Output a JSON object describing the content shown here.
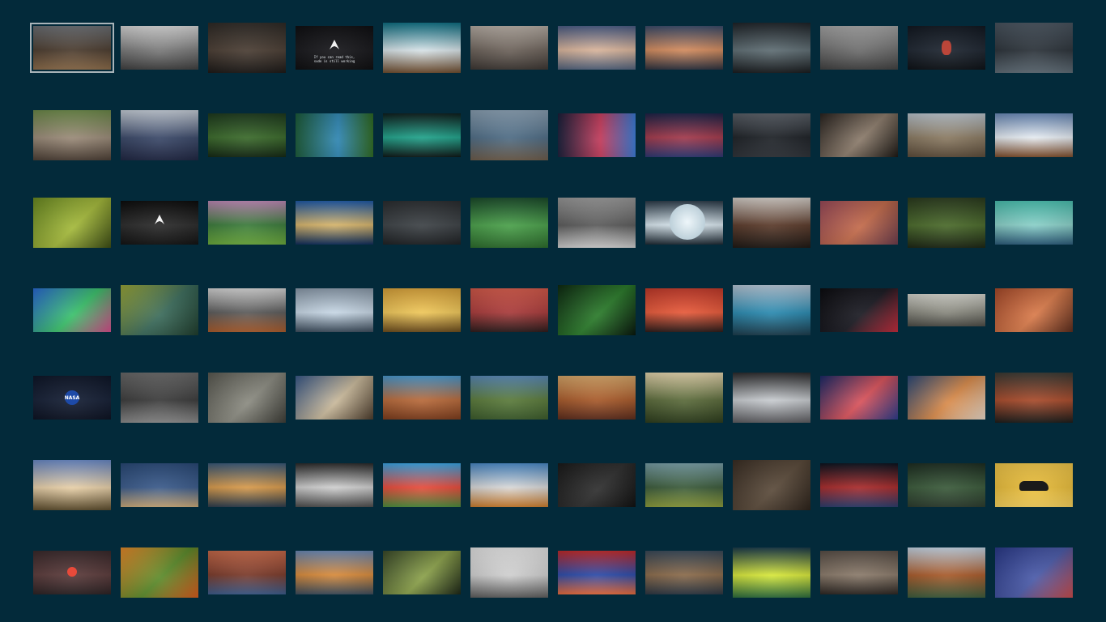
{
  "gallery": {
    "background": "#032a3a",
    "selection_color": "#a9b4b9",
    "columns": 12,
    "rows": 7,
    "selected_index": 0,
    "items": [
      {
        "name": "mountain-cliff-sunset",
        "colors": [
          "#6b6f74",
          "#4a3b2e",
          "#8a6a48"
        ],
        "aspect": "wide",
        "angle": 180
      },
      {
        "name": "beach-bw",
        "colors": [
          "#d9d9d9",
          "#7a7a7a",
          "#3d3d3d"
        ],
        "aspect": "wide",
        "angle": 180
      },
      {
        "name": "forest-path-dark",
        "colors": [
          "#2e2a26",
          "#4a3d33",
          "#1a1715"
        ],
        "aspect": "tall",
        "angle": 180
      },
      {
        "name": "arch-logo-black",
        "colors": [
          "#0f0f12",
          "#16161a",
          "#0c0c0e"
        ],
        "aspect": "wide",
        "angle": 180,
        "logo": "arch",
        "text": "If you can read this,\nsudo is still working"
      },
      {
        "name": "snowy-peaks-teal",
        "colors": [
          "#0d6f83",
          "#d7e3e8",
          "#6b4a2c"
        ],
        "aspect": "tall",
        "angle": 180
      },
      {
        "name": "camera-grey",
        "colors": [
          "#b7aea5",
          "#6c625a",
          "#3a3430"
        ],
        "aspect": "wide",
        "angle": 180
      },
      {
        "name": "road-dusk",
        "colors": [
          "#4b5d86",
          "#d9b49a",
          "#50607a"
        ],
        "aspect": "wide",
        "angle": 180
      },
      {
        "name": "lake-sunset-orange",
        "colors": [
          "#3b4c6b",
          "#d38b5d",
          "#2b2f3c"
        ],
        "aspect": "wide",
        "angle": 180
      },
      {
        "name": "reflection-trees",
        "colors": [
          "#1e2328",
          "#5e6d73",
          "#16191c"
        ],
        "aspect": "tall",
        "angle": 180
      },
      {
        "name": "lone-tree-grey",
        "colors": [
          "#a6a6a6",
          "#6d6d6d",
          "#3f3f3f"
        ],
        "aspect": "wide",
        "angle": 180
      },
      {
        "name": "astronaut-dark",
        "colors": [
          "#121821",
          "#1d2530",
          "#0b0f14"
        ],
        "aspect": "wide",
        "angle": 180,
        "dot": "#d64a3a"
      },
      {
        "name": "figure-concrete",
        "colors": [
          "#4a5560",
          "#2a3138",
          "#5d6a74"
        ],
        "aspect": "tall",
        "angle": 180
      },
      {
        "name": "rocky-shore",
        "colors": [
          "#6d8a4a",
          "#9a8a78",
          "#4a3d33"
        ],
        "aspect": "tall",
        "angle": 180
      },
      {
        "name": "curtain-room",
        "colors": [
          "#c8d0da",
          "#3a4868",
          "#1d2440"
        ],
        "aspect": "tall",
        "angle": 180
      },
      {
        "name": "green-forest-night",
        "colors": [
          "#1e3a1e",
          "#3a6a2a",
          "#122612"
        ],
        "aspect": "wide",
        "angle": 180
      },
      {
        "name": "green-valley-blue",
        "colors": [
          "#1c5c3a",
          "#2f86b3",
          "#2e6a22"
        ],
        "aspect": "wide",
        "angle": 90
      },
      {
        "name": "cyber-neon-room",
        "colors": [
          "#0f1f1e",
          "#20a38b",
          "#0b1615"
        ],
        "aspect": "wide",
        "angle": 180
      },
      {
        "name": "pier-lake",
        "colors": [
          "#8aa0b3",
          "#4d6b84",
          "#6b5a48"
        ],
        "aspect": "tall",
        "angle": 180
      },
      {
        "name": "space-window",
        "colors": [
          "#1a1f3a",
          "#c23a5a",
          "#3a7ad6"
        ],
        "aspect": "wide",
        "angle": 90
      },
      {
        "name": "cloud-red-sky",
        "colors": [
          "#1d2348",
          "#a2384a",
          "#2b3570"
        ],
        "aspect": "wide",
        "angle": 180
      },
      {
        "name": "dark-clouds-city",
        "colors": [
          "#5a6068",
          "#1c2025",
          "#2d3137"
        ],
        "aspect": "wide",
        "angle": 180
      },
      {
        "name": "piano-keys",
        "colors": [
          "#2a2420",
          "#8a7a6a",
          "#1a1612"
        ],
        "aspect": "wide",
        "angle": 135
      },
      {
        "name": "balloon-cliff",
        "colors": [
          "#bcc6cf",
          "#8a7a62",
          "#5a4a38"
        ],
        "aspect": "wide",
        "angle": 180
      },
      {
        "name": "snowy-lake-reflection",
        "colors": [
          "#6a8ab8",
          "#e6ecf2",
          "#7a4a28"
        ],
        "aspect": "wide",
        "angle": 180
      },
      {
        "name": "green-sprouts",
        "colors": [
          "#6a8a22",
          "#a3b83a",
          "#3a4a12"
        ],
        "aspect": "tall",
        "angle": 135
      },
      {
        "name": "arch-logo-smoke",
        "colors": [
          "#0c0c0c",
          "#2a2a2a",
          "#101010"
        ],
        "aspect": "wide",
        "angle": 180,
        "logo": "arch"
      },
      {
        "name": "waterfall-green",
        "colors": [
          "#c08ab8",
          "#3a7a3a",
          "#6aa83a"
        ],
        "aspect": "wide",
        "angle": 180
      },
      {
        "name": "fuji-blue",
        "colors": [
          "#1e5aa8",
          "#d6b46a",
          "#0c2a58"
        ],
        "aspect": "wide",
        "angle": 180
      },
      {
        "name": "bicycle-dark",
        "colors": [
          "#2a2d30",
          "#3d4246",
          "#1c1f22"
        ],
        "aspect": "wide",
        "angle": 180
      },
      {
        "name": "green-bokeh",
        "colors": [
          "#1a4a2a",
          "#4aa04a",
          "#2a6a2a"
        ],
        "aspect": "tall",
        "angle": 180
      },
      {
        "name": "grey-cubes",
        "colors": [
          "#9a9a9a",
          "#5a5a5a",
          "#cfcfcf"
        ],
        "aspect": "tall",
        "angle": 180
      },
      {
        "name": "moon-ship",
        "colors": [
          "#2a3a48",
          "#d8e6ee",
          "#1a2630"
        ],
        "aspect": "wide",
        "angle": 180,
        "moon": true
      },
      {
        "name": "sea-cave-fire",
        "colors": [
          "#d8d2cc",
          "#5a3a2a",
          "#1c1612"
        ],
        "aspect": "tall",
        "angle": 180
      },
      {
        "name": "pink-abstract-map",
        "colors": [
          "#9a4a5a",
          "#c26a4a",
          "#6a3a4a"
        ],
        "aspect": "wide",
        "angle": 135
      },
      {
        "name": "redwood-forest",
        "colors": [
          "#2a3a1e",
          "#4a6a2a",
          "#1a2412"
        ],
        "aspect": "tall",
        "angle": 180
      },
      {
        "name": "city-skyline-teal",
        "colors": [
          "#4ac0b0",
          "#8ad0c8",
          "#2a5a78"
        ],
        "aspect": "wide",
        "angle": 180
      },
      {
        "name": "paint-hands",
        "colors": [
          "#2a6ad6",
          "#3ac06a",
          "#d64a8a"
        ],
        "aspect": "wide",
        "angle": 135
      },
      {
        "name": "misty-forest-yellow",
        "colors": [
          "#9aa83a",
          "#3a6a5a",
          "#1c3a2a"
        ],
        "aspect": "tall",
        "angle": 135
      },
      {
        "name": "autumn-mountain-mist",
        "colors": [
          "#d8d8d8",
          "#5a5a5a",
          "#a85a2a"
        ],
        "aspect": "wide",
        "angle": 180
      },
      {
        "name": "iceberg",
        "colors": [
          "#8a9aaa",
          "#c8d8e6",
          "#3a4a5a"
        ],
        "aspect": "wide",
        "angle": 180
      },
      {
        "name": "golden-sunrise-field",
        "colors": [
          "#d8a23a",
          "#f0c85a",
          "#6a4a1a"
        ],
        "aspect": "wide",
        "angle": 180
      },
      {
        "name": "red-palm-street",
        "colors": [
          "#d45a4a",
          "#a83a3a",
          "#2a1a1a"
        ],
        "aspect": "wide",
        "angle": 180
      },
      {
        "name": "green-abstract-dark",
        "colors": [
          "#0e2a12",
          "#2a7a2a",
          "#06140a"
        ],
        "aspect": "tall",
        "angle": 135
      },
      {
        "name": "red-anime-fighter",
        "colors": [
          "#c23a2a",
          "#e85a3a",
          "#2a1a18"
        ],
        "aspect": "wide",
        "angle": 180
      },
      {
        "name": "lake-mountains-cyan",
        "colors": [
          "#b8c8d8",
          "#2a8ab0",
          "#1a3a4a"
        ],
        "aspect": "tall",
        "angle": 180
      },
      {
        "name": "red-black-minimal",
        "colors": [
          "#0c0c10",
          "#1a1a22",
          "#c22a3a"
        ],
        "aspect": "wide",
        "angle": 135
      },
      {
        "name": "misty-rail",
        "colors": [
          "#d8d8d0",
          "#8a8a80",
          "#4a4a44"
        ],
        "aspect": "short",
        "angle": 180
      },
      {
        "name": "orange-leaf-macro",
        "colors": [
          "#a84a2a",
          "#d87a4a",
          "#5a2a1a"
        ],
        "aspect": "wide",
        "angle": 135
      },
      {
        "name": "nasa-space",
        "colors": [
          "#0e1628",
          "#141e34",
          "#0a1020"
        ],
        "aspect": "wide",
        "angle": 180,
        "nasa": "NASA"
      },
      {
        "name": "foggy-pier",
        "colors": [
          "#6a6a6a",
          "#3a3a3a",
          "#8a8a8a"
        ],
        "aspect": "tall",
        "angle": 180
      },
      {
        "name": "wooden-stairs",
        "colors": [
          "#5a5a52",
          "#8a8a80",
          "#3a3a34"
        ],
        "aspect": "tall",
        "angle": 135
      },
      {
        "name": "icy-rocks-lake",
        "colors": [
          "#3a5a8a",
          "#c8b89a",
          "#4a3a2a"
        ],
        "aspect": "wide",
        "angle": 135
      },
      {
        "name": "monument-valley",
        "colors": [
          "#4a9ad0",
          "#b86a3a",
          "#7a3a1a"
        ],
        "aspect": "wide",
        "angle": 180
      },
      {
        "name": "valley-river",
        "colors": [
          "#5a8ab8",
          "#5a7a3a",
          "#3a5a2a"
        ],
        "aspect": "wide",
        "angle": 180
      },
      {
        "name": "canyon-sunset",
        "colors": [
          "#d8a86a",
          "#a85a2a",
          "#5a2a1a"
        ],
        "aspect": "wide",
        "angle": 180
      },
      {
        "name": "blurry-field-sun",
        "colors": [
          "#e8d8b0",
          "#5a6a3a",
          "#2a3a1a"
        ],
        "aspect": "tall",
        "angle": 180
      },
      {
        "name": "minimal-bedroom",
        "colors": [
          "#2a2a2c",
          "#c8ccd0",
          "#5a5a5e"
        ],
        "aspect": "tall",
        "angle": 180
      },
      {
        "name": "anime-girl-red",
        "colors": [
          "#1a2a6a",
          "#d8525a",
          "#2a3a8a"
        ],
        "aspect": "wide",
        "angle": 135
      },
      {
        "name": "desert-sunset-clouds",
        "colors": [
          "#2a4a7a",
          "#d88a4a",
          "#e8d8c8"
        ],
        "aspect": "wide",
        "angle": 135
      },
      {
        "name": "autumn-leaves-path",
        "colors": [
          "#3a3a34",
          "#a84a2a",
          "#1a1a18"
        ],
        "aspect": "tall",
        "angle": 180
      },
      {
        "name": "white-chapel",
        "colors": [
          "#6a8ac8",
          "#e8d0a8",
          "#5a4a2a"
        ],
        "aspect": "tall",
        "angle": 180
      },
      {
        "name": "deck-ocean",
        "colors": [
          "#2a4a78",
          "#3a5a8a",
          "#c8a878"
        ],
        "aspect": "wide",
        "angle": 180
      },
      {
        "name": "lake-sunset-cliffs",
        "colors": [
          "#3a5a7a",
          "#d89a4a",
          "#2a3a4a"
        ],
        "aspect": "wide",
        "angle": 180
      },
      {
        "name": "bw-coast",
        "colors": [
          "#2a2a2a",
          "#d0d0d0",
          "#4a4a4a"
        ],
        "aspect": "wide",
        "angle": 180
      },
      {
        "name": "hot-air-balloons",
        "colors": [
          "#3aa8e8",
          "#e84a3a",
          "#4a8a3a"
        ],
        "aspect": "wide",
        "angle": 180
      },
      {
        "name": "autumn-mountains",
        "colors": [
          "#4a8ac8",
          "#d8d8d8",
          "#c87a2a"
        ],
        "aspect": "wide",
        "angle": 180
      },
      {
        "name": "dark-dragon",
        "colors": [
          "#1a1a1a",
          "#2e2e2e",
          "#0e0e0e"
        ],
        "aspect": "wide",
        "angle": 135
      },
      {
        "name": "green-plains",
        "colors": [
          "#7aa0a8",
          "#3a5a3a",
          "#8a9a3a"
        ],
        "aspect": "wide",
        "angle": 180
      },
      {
        "name": "wood-coffee",
        "colors": [
          "#3a2e24",
          "#5a4a3a",
          "#2a2018"
        ],
        "aspect": "tall",
        "angle": 135
      },
      {
        "name": "avengers",
        "colors": [
          "#0c1420",
          "#a82a2a",
          "#2a3a6a"
        ],
        "aspect": "wide",
        "angle": 180
      },
      {
        "name": "mossy-forest",
        "colors": [
          "#1e2e22",
          "#3a5a3a",
          "#2a3a2c"
        ],
        "aspect": "wide",
        "angle": 180
      },
      {
        "name": "yellow-car",
        "colors": [
          "#f2c84a",
          "#e8bc3a",
          "#f6d05a"
        ],
        "aspect": "wide",
        "angle": 180,
        "car": true
      },
      {
        "name": "red-sun-sea",
        "colors": [
          "#3a2a2c",
          "#5a3a3a",
          "#2a2022"
        ],
        "aspect": "wide",
        "angle": 180,
        "sun": true
      },
      {
        "name": "orange-autumn-bokeh",
        "colors": [
          "#e88a2a",
          "#5a8a2a",
          "#d85a1a"
        ],
        "aspect": "tall",
        "angle": 135
      },
      {
        "name": "grand-canyon",
        "colors": [
          "#c86a4a",
          "#7a3a2a",
          "#3a5a8a"
        ],
        "aspect": "wide",
        "angle": 180
      },
      {
        "name": "lake-chair",
        "colors": [
          "#6a8ab8",
          "#d88a3a",
          "#3a4a5a"
        ],
        "aspect": "wide",
        "angle": 180
      },
      {
        "name": "bamboo-macro",
        "colors": [
          "#3a4a2a",
          "#8aa04a",
          "#1a2414"
        ],
        "aspect": "wide",
        "angle": 135
      },
      {
        "name": "minimal-grey-boat",
        "colors": [
          "#e6e6e6",
          "#d0d0d0",
          "#5a5a5a"
        ],
        "aspect": "tall",
        "angle": 180
      },
      {
        "name": "red-sky-reflection",
        "colors": [
          "#c22a2a",
          "#2a4aa8",
          "#e86a3a"
        ],
        "aspect": "wide",
        "angle": 180
      },
      {
        "name": "city-aerial",
        "colors": [
          "#3a4a5a",
          "#8a6a4a",
          "#2a3440"
        ],
        "aspect": "wide",
        "angle": 180
      },
      {
        "name": "escalator-neon",
        "colors": [
          "#1a3a4a",
          "#d8e83a",
          "#2a6a3a"
        ],
        "aspect": "tall",
        "angle": 180
      },
      {
        "name": "stormy-mountains",
        "colors": [
          "#5a5048",
          "#8a7a6a",
          "#2a2420"
        ],
        "aspect": "wide",
        "angle": 180
      },
      {
        "name": "waterfall-autumn",
        "colors": [
          "#c8d8e8",
          "#a85a2a",
          "#3a5a3a"
        ],
        "aspect": "tall",
        "angle": 180
      },
      {
        "name": "red-ball-bokeh",
        "colors": [
          "#2a3a8a",
          "#4a5aa8",
          "#c84a4a"
        ],
        "aspect": "tall",
        "angle": 135
      }
    ]
  }
}
